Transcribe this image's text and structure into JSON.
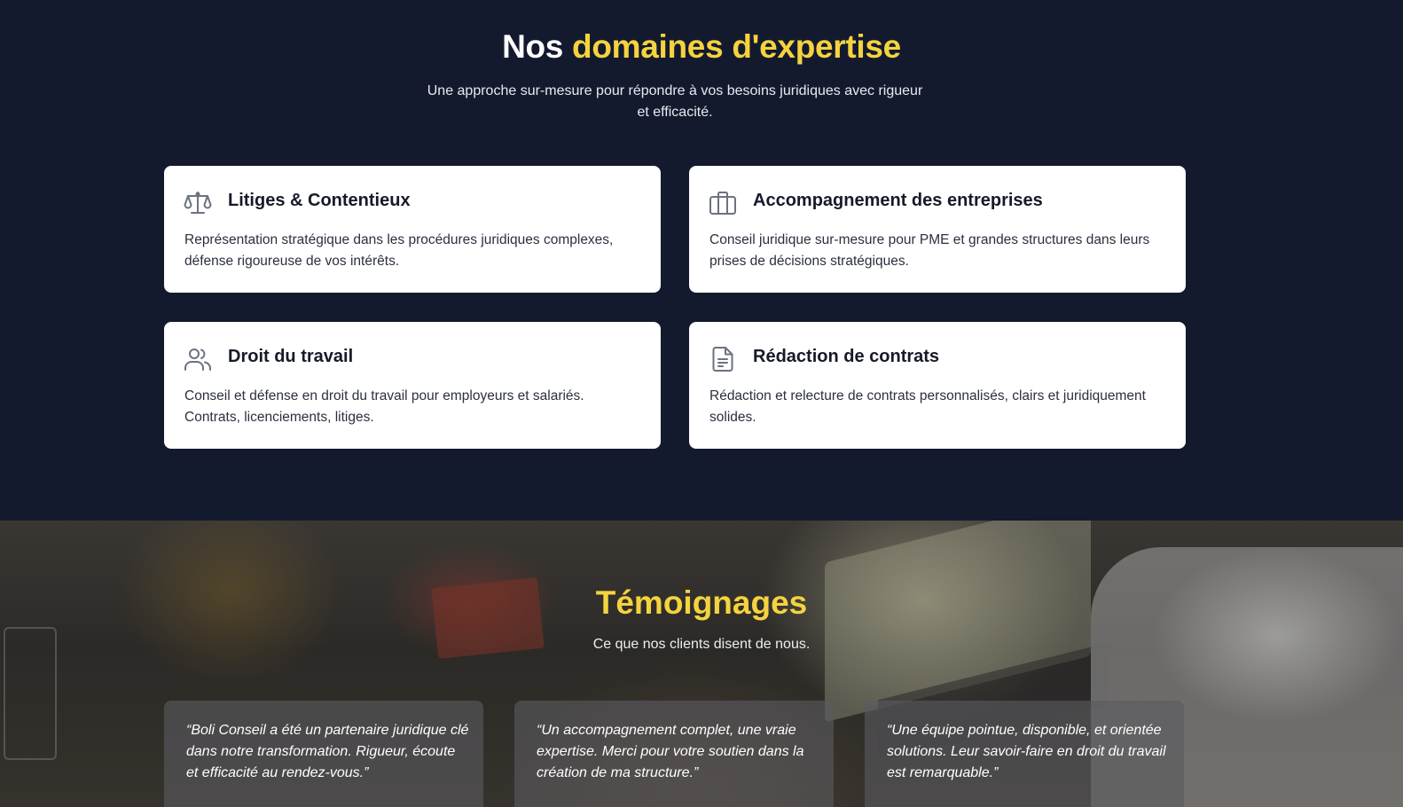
{
  "expertise": {
    "title_prefix": "Nos",
    "title_highlight": "domaines d'expertise",
    "subtitle": "Une approche sur-mesure pour répondre à vos besoins juridiques avec rigueur et efficacité.",
    "cards": [
      {
        "icon": "scale-icon",
        "title": "Litiges & Contentieux",
        "description": "Représentation stratégique dans les procédures juridiques complexes, défense rigoureuse de vos intérêts."
      },
      {
        "icon": "briefcase-icon",
        "title": "Accompagnement des entreprises",
        "description": "Conseil juridique sur-mesure pour PME et grandes structures dans leurs prises de décisions stratégiques."
      },
      {
        "icon": "users-icon",
        "title": "Droit du travail",
        "description": "Conseil et défense en droit du travail pour employeurs et salariés. Contrats, licenciements, litiges."
      },
      {
        "icon": "document-icon",
        "title": "Rédaction de contrats",
        "description": "Rédaction et relecture de contrats personnalisés, clairs et juridiquement solides."
      }
    ]
  },
  "testimonials": {
    "title": "Témoignages",
    "subtitle": "Ce que nos clients disent de nous.",
    "items": [
      {
        "quote": "“Boli Conseil a été un partenaire juridique clé dans notre transformation. Rigueur, écoute et efficacité au rendez-vous.”"
      },
      {
        "quote": "“Un accompagnement complet, une vraie expertise. Merci pour votre soutien dans la création de ma structure.”"
      },
      {
        "quote": "“Une équipe pointue, disponible, et orientée solutions. Leur savoir-faire en droit du travail est remarquable.”"
      }
    ]
  },
  "colors": {
    "navy_background": "#141a2e",
    "accent_yellow": "#f5d33f",
    "card_white": "#ffffff",
    "icon_gray": "#6b7280"
  }
}
